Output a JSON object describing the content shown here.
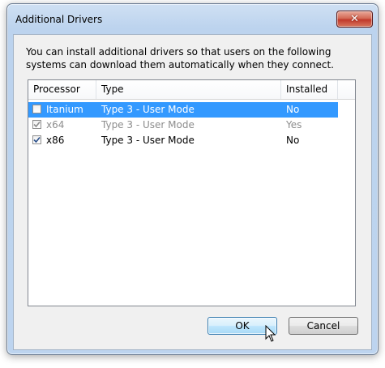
{
  "window": {
    "title": "Additional Drivers",
    "close_symbol": "✕"
  },
  "description": "You can install additional drivers so that users on the following systems can download them automatically when they connect.",
  "list": {
    "columns": [
      "Processor",
      "Type",
      "Installed"
    ],
    "rows": [
      {
        "checked": false,
        "processor": "Itanium",
        "type": "Type 3 - User Mode",
        "installed": "No",
        "selected": true,
        "disabled": false
      },
      {
        "checked": true,
        "processor": "x64",
        "type": "Type 3 - User Mode",
        "installed": "Yes",
        "selected": false,
        "disabled": true
      },
      {
        "checked": true,
        "processor": "x86",
        "type": "Type 3 - User Mode",
        "installed": "No",
        "selected": false,
        "disabled": false
      }
    ]
  },
  "buttons": {
    "ok": "OK",
    "cancel": "Cancel"
  },
  "colors": {
    "selection": "#3399ff",
    "default_button_border": "#3c7fb1"
  }
}
